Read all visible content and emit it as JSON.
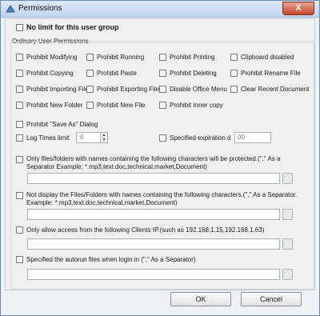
{
  "window": {
    "title": "Permissions",
    "close_glyph": "X"
  },
  "no_limit": {
    "label": "No limit for this user group",
    "checked": false
  },
  "ordinary_group": {
    "label": "Ordinary User Permissions",
    "grid": [
      [
        "Prohibit Modifying",
        "Prohibit Running",
        "Prohibit Printing",
        "Clipboard disabled"
      ],
      [
        "Prohibit Copying",
        "Prohibit Paste",
        "Prohibit Deleting",
        "Prohibit Rename File"
      ],
      [
        "Prohibit Importing File",
        "Prohibit Exporting Files",
        "Disable Office Menu",
        "Clear Recent Document"
      ],
      [
        "Prohibit New Folder",
        "Prohibit New File",
        "Prohibit Inner copy"
      ]
    ],
    "save_as": "Prohibit \"Save As\" Dialog",
    "log_times": {
      "label": "Log Times limit",
      "value": "0"
    },
    "expiration": {
      "label": "Specified expiration d",
      "value": "00"
    },
    "protected_names": {
      "label": "Only files/folders with names containing the following characters will be protected.(\",\" As a Separator Example: *.mp3,text.doc,technical,market,Document)",
      "value": ""
    },
    "hidden_names": {
      "label": "Not display the Files/Folders with names containing the following characters.(\",\" As a Separator. Example: *.mp3,text.doc,technical,market,Document)",
      "value": ""
    },
    "client_ip": {
      "label": "Only allow access from the following Clients IP.(such as 192.168.1.15,192.168.1.63)",
      "value": ""
    },
    "autorun": {
      "label": "Specified the autorun files when login in (\",\" As a Separator)",
      "value": ""
    }
  },
  "buttons": {
    "ok": "OK",
    "cancel": "Cancel"
  },
  "colors": {
    "title_bar": "#c3d5ec",
    "close": "#c6452c",
    "dialog_bg": "#f0f0f0"
  }
}
